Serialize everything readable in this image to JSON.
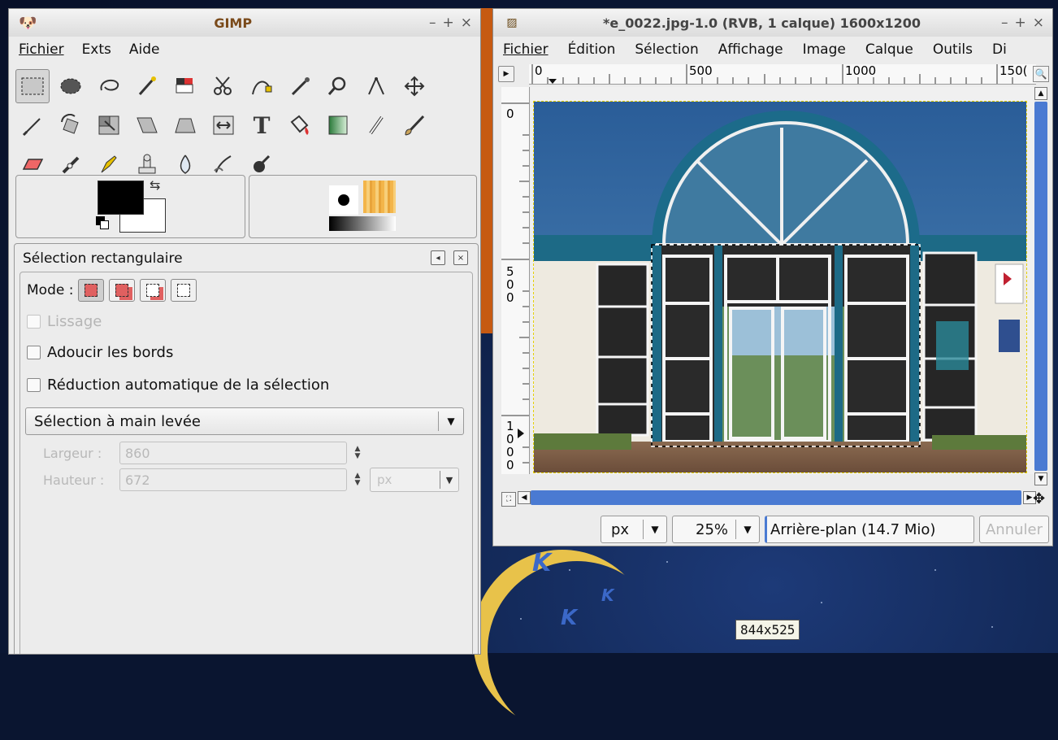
{
  "toolbox": {
    "title": "GIMP",
    "menu": [
      "Fichier",
      "Exts",
      "Aide"
    ],
    "tools_row1": [
      "rect-select",
      "ellipse-select",
      "free-select",
      "fuzzy-select",
      "select-by-color",
      "scissors-select",
      "paths",
      "color-picker",
      "zoom",
      "measure",
      "move"
    ],
    "tools_row2": [
      "crop",
      "rotate",
      "scale",
      "shear",
      "perspective",
      "flip",
      "text",
      "bucket-fill",
      "blend",
      "pencil",
      "paintbrush"
    ],
    "tools_row3": [
      "eraser",
      "airbrush",
      "ink",
      "clone",
      "blur",
      "smudge",
      "dodge-burn"
    ]
  },
  "tool_options": {
    "title": "Sélection rectangulaire",
    "mode_label": "Mode :",
    "antialias": "Lissage",
    "feather": "Adoucir les bords",
    "auto_shrink": "Réduction automatique de la sélection",
    "select_mode": "Sélection à main levée",
    "width_label": "Largeur :",
    "width_value": "860",
    "height_label": "Hauteur :",
    "height_value": "672",
    "unit": "px"
  },
  "image_window": {
    "title": "*e_0022.jpg-1.0 (RVB, 1 calque) 1600x1200",
    "menu": [
      "Fichier",
      "Édition",
      "Sélection",
      "Affichage",
      "Image",
      "Calque",
      "Outils",
      "Di"
    ],
    "hruler_labels": [
      "0",
      "500",
      "1000",
      "150("
    ],
    "vruler_labels": [
      "0",
      "5\n0\n0",
      "1\n0\n0\n0"
    ],
    "status_unit": "px",
    "status_zoom": "25%",
    "status_layer": "Arrière-plan (14.7 Mio)",
    "status_cancel": "Annuler"
  },
  "desktop": {
    "size_tooltip": "844x525"
  },
  "colors": {
    "scrollbar": "#4a7ad2",
    "sky": "#2f6aa8",
    "frame_teal": "#1f6f8f"
  }
}
